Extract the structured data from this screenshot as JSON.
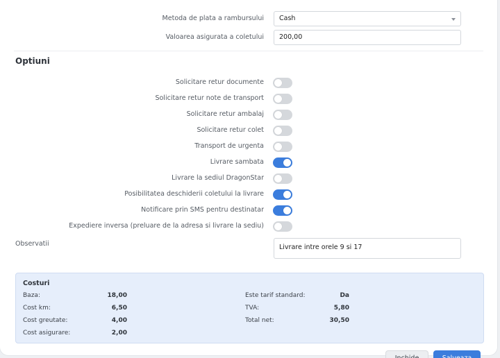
{
  "form": {
    "payment_method_label": "Metoda de plata a rambursului",
    "payment_method_value": "Cash",
    "insured_value_label": "Valoarea asigurata a coletului",
    "insured_value": "200,00"
  },
  "options": {
    "title": "Optiuni",
    "items": [
      {
        "label": "Solicitare retur documente",
        "on": false
      },
      {
        "label": "Solicitare retur note de transport",
        "on": false
      },
      {
        "label": "Solicitare retur ambalaj",
        "on": false
      },
      {
        "label": "Solicitare retur colet",
        "on": false
      },
      {
        "label": "Transport de urgenta",
        "on": false
      },
      {
        "label": "Livrare sambata",
        "on": true
      },
      {
        "label": "Livrare la sediul DragonStar",
        "on": false
      },
      {
        "label": "Posibilitatea deschiderii coletului la livrare",
        "on": true
      },
      {
        "label": "Notificare prin SMS pentru destinatar",
        "on": true
      },
      {
        "label": "Expediere inversa (preluare de la adresa si livrare la sediu)",
        "on": false
      }
    ]
  },
  "observations": {
    "label": "Observatii",
    "value": "Livrare intre orele 9 si 17"
  },
  "costs": {
    "title": "Costuri",
    "left": [
      {
        "key": "Baza:",
        "value": "18,00"
      },
      {
        "key": "Cost km:",
        "value": "6,50"
      },
      {
        "key": "Cost greutate:",
        "value": "4,00"
      },
      {
        "key": "Cost asigurare:",
        "value": "2,00"
      }
    ],
    "right": [
      {
        "key": "Este tarif standard:",
        "value": "Da"
      },
      {
        "key": "TVA:",
        "value": "5,80"
      },
      {
        "key": "Total net:",
        "value": "30,50"
      }
    ]
  },
  "footer": {
    "close_label": "Inchide",
    "save_label": "Salveaza"
  },
  "colors": {
    "accent": "#3b7ddd",
    "toggle_off": "#d5d8dc",
    "costs_bg": "#e6eefb"
  }
}
